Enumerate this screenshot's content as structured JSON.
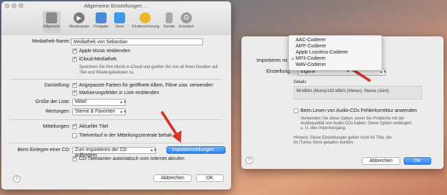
{
  "general_window": {
    "title": "Allgemeine Einstellungen …",
    "toolbar": [
      {
        "label": "Allgemein",
        "icon": "switch-icon"
      },
      {
        "label": "Wiedergabe",
        "icon": "play-icon"
      },
      {
        "label": "Freigabe",
        "icon": "share-icon"
      },
      {
        "label": "Store",
        "icon": "store-icon"
      },
      {
        "label": "Kindersicherung",
        "icon": "parental-icon"
      },
      {
        "label": "Geräte",
        "icon": "devices-icon"
      },
      {
        "label": "Erweitert",
        "icon": "gear-icon"
      }
    ],
    "library_name_label": "Mediathek-Name:",
    "library_name_value": "Mediathek von Sebastian",
    "apple_music_label": "Apple Music einblenden",
    "icloud_label": "iCloud-Mediathek",
    "icloud_desc_1": "Speichern Sie Ihre Musik in iCloud und greifen Sie von all Ihren Geräten auf",
    "icloud_desc_2": "Titel und Wiedergabelisten zu.",
    "display_label": "Darstellung:",
    "adapted_colors_label": "Angepasste Farben für geöffnete Alben, Filme usw. verwenden",
    "marking_fields_label": "Markierungsfelder in Liste einblenden",
    "list_size_label": "Größe der Liste:",
    "list_size_value": "Mittel",
    "ratings_label": "Wertungen:",
    "ratings_value": "Sterne & Favoriten",
    "notifications_label": "Mitteilungen:",
    "current_title_label": "Aktueller Titel",
    "title_history_label": "Titelverlauf in der Mitteilungszentrale behalt",
    "cd_insert_label": "Beim Einlegen einer CD:",
    "cd_insert_value": "Zum Importieren der CD auffordern",
    "import_settings_button": "Importeinstellungen …",
    "cd_titles_label": "CD-Titelnamen automatisch vom Internet abrufen",
    "cancel_button": "Abbrechen",
    "ok_button": "OK",
    "help": "?"
  },
  "import_window": {
    "import_with_label": "Importieren mi",
    "setting_label": "Einstellung:",
    "setting_value": "Eigene",
    "menu": {
      "items": [
        "AAC-Codierer",
        "AIFF-Codierer",
        "Apple Lossless-Codierer",
        "MP3-Codierer",
        "WAV-Codierer"
      ],
      "selected_index": 3
    },
    "details_heading": "Details",
    "details_text": "96 kBit/s (Mono)/192 kBit/s (Stereo), Stereo (Joint).",
    "error_correction_label": "Beim Lesen von Audio-CDs Fehlerkorrektur anwenden",
    "error_desc_1": "Verwenden Sie diese Option, wenn Sie Probleme mit der",
    "error_desc_2": "Audioqualität von Audio-CDs haben. Diese Option verlängert",
    "error_desc_3": "u. U. den Importvorgang.",
    "note_1": "Hinweis: Diese Einstellungen gelten nicht für Titel, die",
    "note_2": "im iTunes Store geladen wurden.",
    "cancel_button": "Abbrechen",
    "ok_button": "OK",
    "help": "?"
  },
  "colors": {
    "accent": "#2c82f0",
    "arrow": "#d6362a"
  }
}
